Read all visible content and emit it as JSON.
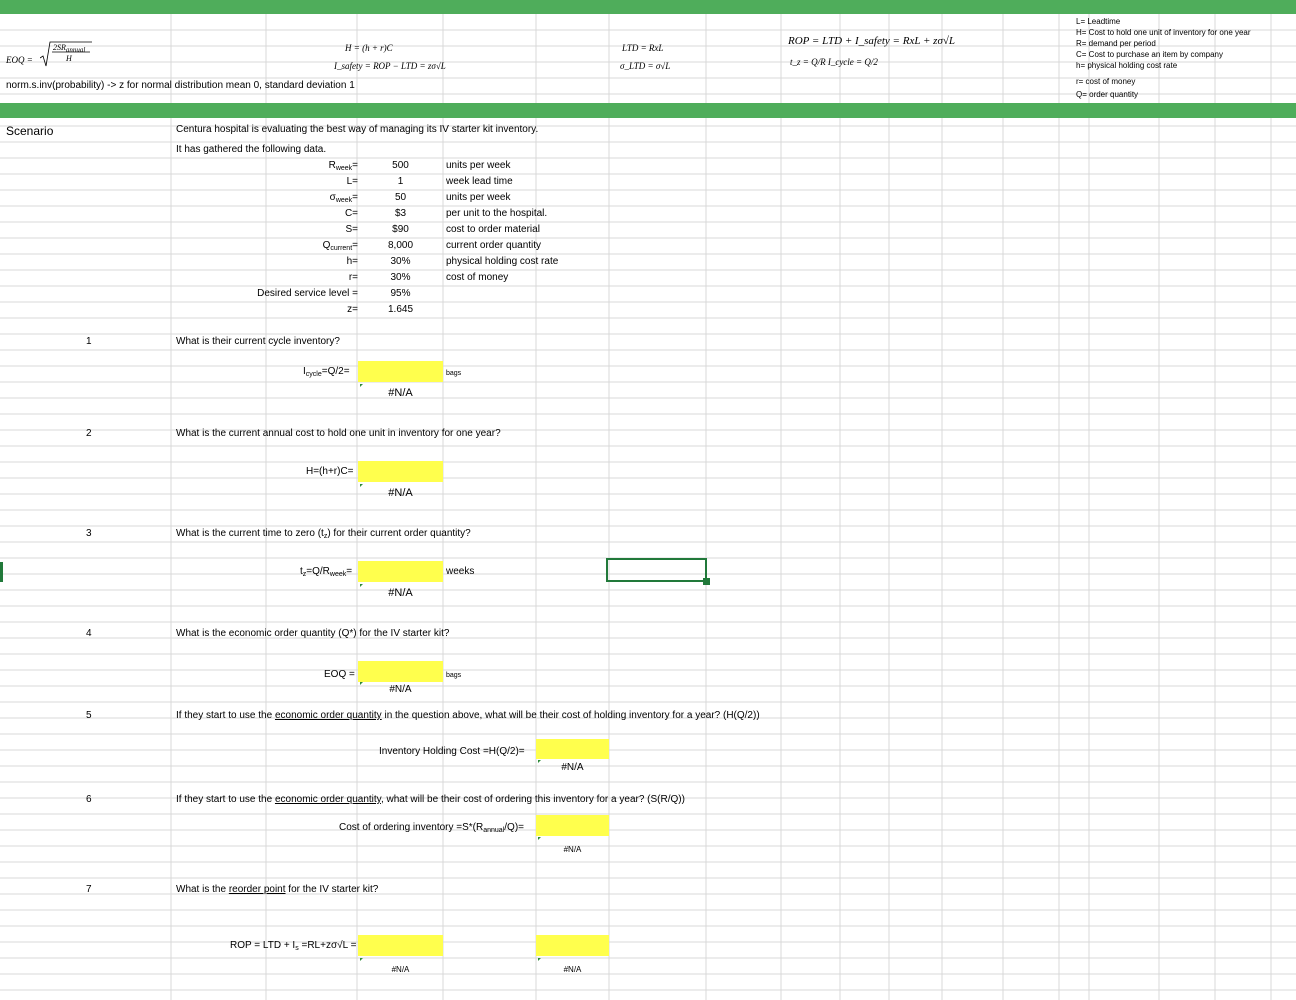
{
  "formulas": {
    "eoq_lhs": "EOQ =",
    "eoq_num": "2SR",
    "eoq_num_sub": "annual",
    "eoq_den": "H",
    "h_formula": "H = (h + r)C",
    "isafety_formula": "I_safety = ROP − LTD = zσ√L",
    "ltd_formula": "LTD = RxL",
    "sigma_ltd_formula": "σ_LTD = σ√L",
    "rop_formula": "ROP = LTD + I_safety = RxL + zσ√L",
    "tz_formula": "t_z = Q/R   I_cycle = Q/2",
    "norm_note": "norm.s.inv(probability) -> z for normal distribution mean 0, standard deviation 1"
  },
  "legend": [
    "L= Leadtime",
    "H= Cost to hold one unit of inventory for one year",
    "R= demand per period",
    "C= Cost to purchase an item by company",
    "h= physical holding cost rate",
    "r= cost of money",
    "Q= order quantity"
  ],
  "scenario": {
    "label": "Scenario",
    "intro1": "Centura hospital is evaluating the best way of managing its IV starter kit inventory.",
    "intro2": "It has gathered the following data."
  },
  "params": [
    {
      "label": "R",
      "sub": "week",
      "suffix": "=",
      "value": "500",
      "unit": "units per week"
    },
    {
      "label": "L=",
      "sub": "",
      "suffix": "",
      "value": "1",
      "unit": "week lead time"
    },
    {
      "label": "σ",
      "sub": "week",
      "suffix": "=",
      "value": "50",
      "unit": "units per week"
    },
    {
      "label": "C=",
      "sub": "",
      "suffix": "",
      "value": "$3",
      "unit": "per unit to the hospital."
    },
    {
      "label": "S=",
      "sub": "",
      "suffix": "",
      "value": "$90",
      "unit": "cost to order material"
    },
    {
      "label": "Q",
      "sub": "current",
      "suffix": "=",
      "value": "8,000",
      "unit": "current order quantity"
    },
    {
      "label": "h=",
      "sub": "",
      "suffix": "",
      "value": "30%",
      "unit": "physical holding cost rate"
    },
    {
      "label": "r=",
      "sub": "",
      "suffix": "",
      "value": "30%",
      "unit": "cost of money"
    },
    {
      "label": "Desired service level =",
      "sub": "",
      "suffix": "",
      "value": "95%",
      "unit": ""
    },
    {
      "label": "z=",
      "sub": "",
      "suffix": "",
      "value": "1.645",
      "unit": ""
    }
  ],
  "questions": [
    {
      "num": "1",
      "text": "What is their current cycle inventory?",
      "formula_pre": "I",
      "formula_sub": "cycle",
      "formula_post": "=Q/2=",
      "unit": "bags",
      "result": "#N/A"
    },
    {
      "num": "2",
      "text": "What is the current annual cost to hold one unit in inventory for one year?",
      "formula_pre": "H=(h+r)C=",
      "formula_sub": "",
      "formula_post": "",
      "unit": "",
      "result": "#N/A"
    },
    {
      "num": "3",
      "text_pre": "What is the current time to zero (t",
      "text_sub": "z",
      "text_post": ") for their current order quantity?",
      "formula_pre": "t",
      "formula_sub": "z",
      "formula_mid": "=Q/R",
      "formula_sub2": "week",
      "formula_post": "=",
      "unit": "weeks",
      "result": "#N/A"
    },
    {
      "num": "4",
      "text": "What is the economic order quantity (Q*) for the IV starter kit?",
      "formula_pre": "EOQ =",
      "unit": "bags",
      "result": "#N/A"
    },
    {
      "num": "5",
      "text_pre": "If they start to use the ",
      "text_link": "economic order quantity",
      "text_post": " in the question above, what will be their cost of holding inventory for a year? (H(Q/2))",
      "formula_pre": "Inventory Holding Cost =H(Q/2)=",
      "result": "#N/A"
    },
    {
      "num": "6",
      "text_pre": "If they start to use the ",
      "text_link": "economic order quantity",
      "text_post": ", what will be their cost of ordering this inventory for a year? (S(R/Q))",
      "formula_pre": "Cost of ordering inventory =S*(R",
      "formula_sub": "annual",
      "formula_post": "/Q)=",
      "result": "#N/A"
    },
    {
      "num": "7",
      "text_pre": "What is the ",
      "text_link": "reorder point",
      "text_post": " for the IV starter kit?",
      "formula_pre": "ROP = LTD + I",
      "formula_sub": "s",
      "formula_post": " =RL+zσ√L =",
      "result1": "#N/A",
      "result2": "#N/A"
    }
  ],
  "colors": {
    "band": "#4fad5b",
    "input": "#ffff4d",
    "selection": "#21793a",
    "grid": "#d9d9d9"
  }
}
